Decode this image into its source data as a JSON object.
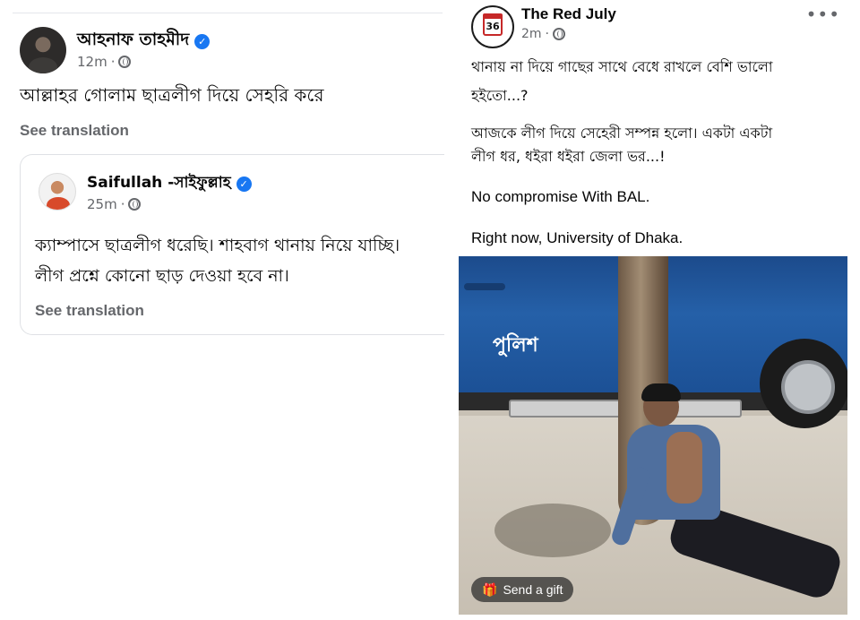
{
  "left_post": {
    "author": "আহনাফ তাহমীদ",
    "time": "12m",
    "text": "আল্লাহর গোলাম ছাত্রলীগ দিয়ে সেহরি করে",
    "see_translation": "See translation",
    "shared_post": {
      "author": "Saifullah -সাইফুল্লাহ",
      "time": "25m",
      "text_line1": "ক্যাম্পাসে ছাত্রলীগ ধরেছি। শাহবাগ থানায় নিয়ে যাচ্ছি।",
      "text_line2": "লীগ প্রশ্নে কোনো ছাড় দেওয়া হবে না।",
      "see_translation": "See translation"
    }
  },
  "right_post": {
    "page_name": "The Red July",
    "avatar_text": "36",
    "time": "2m",
    "more": "•••",
    "line1": "থানায় না দিয়ে গাছের সাথে বেধে রাখলে বেশি ভালো",
    "line2": "হইতো...?",
    "line3": "আজকে লীগ দিয়ে সেহেরী সম্পন্ন হলো। একটা একটা",
    "line4": "লীগ ধর, ধইরা ধইরা জেলা ভর...!",
    "line5": "No compromise With BAL.",
    "line6": "Right now, University of Dhaka.",
    "photo_label": "পুলিশ",
    "gift_button": "Send a gift"
  },
  "icons": {
    "verified": "verified-badge-icon",
    "privacy": "globe-icon",
    "gift": "gift-icon"
  },
  "colors": {
    "verified": "#1877f2",
    "meta_text": "#65676b"
  }
}
